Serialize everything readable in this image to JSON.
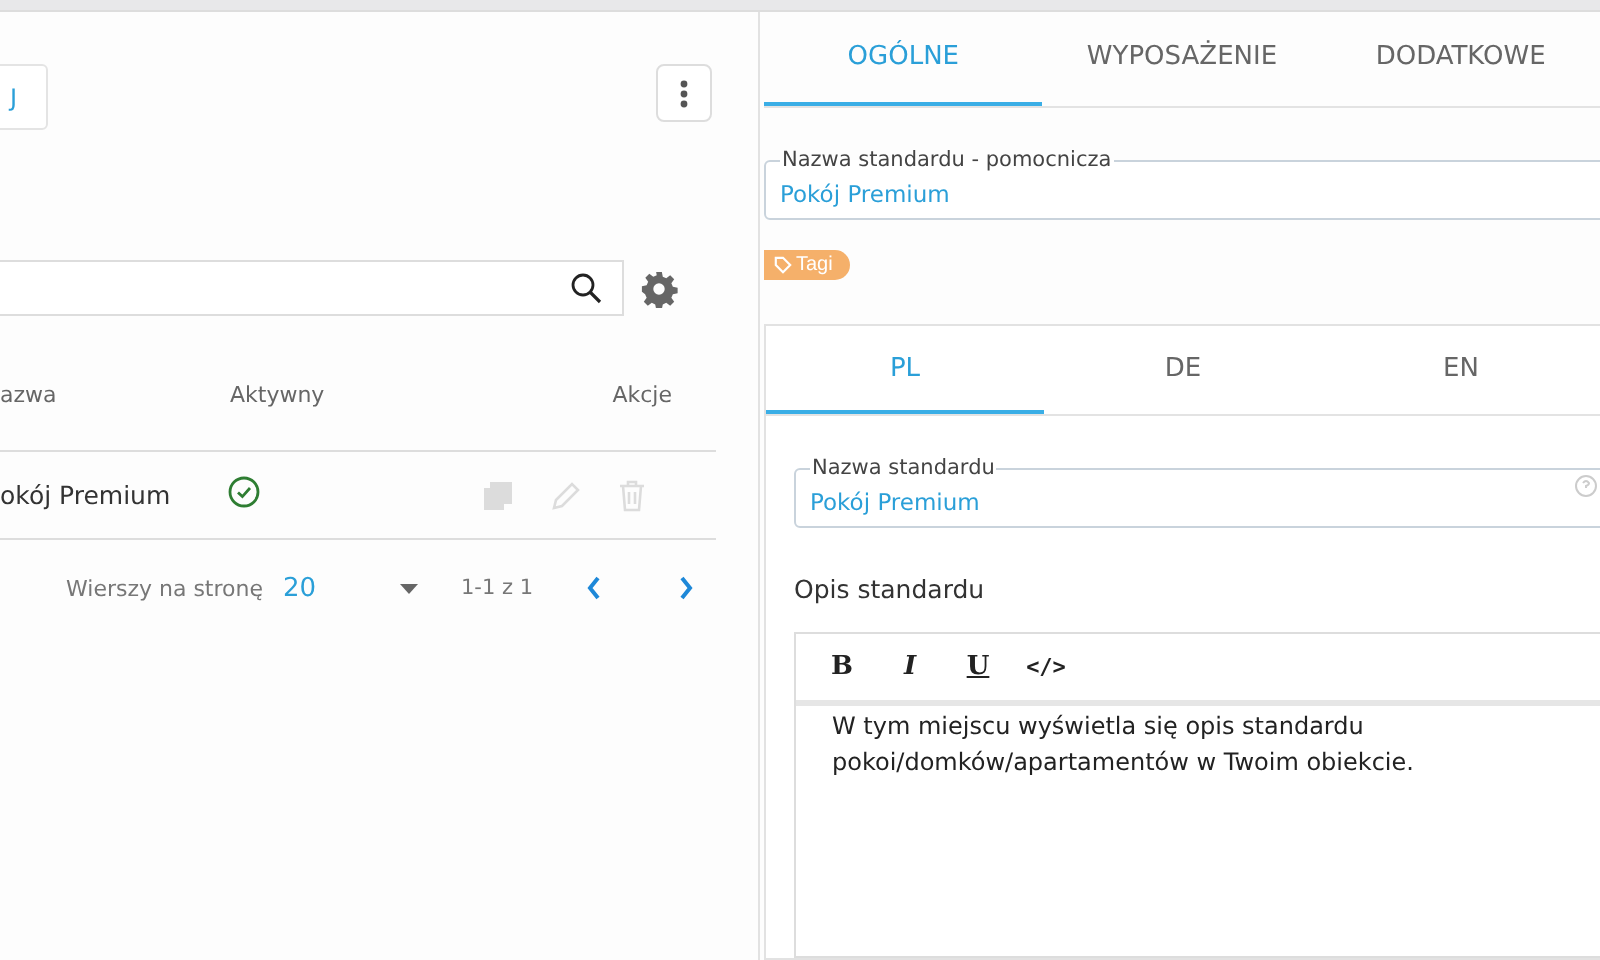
{
  "left_panel": {
    "add_button": {
      "label": "J"
    },
    "table": {
      "columns": [
        "azwa",
        "Aktywny",
        "Akcje"
      ],
      "rows": [
        {
          "name": "okój Premium",
          "active": true,
          "actions": [
            {
              "kind": "copy",
              "disabled": true
            },
            {
              "kind": "edit",
              "disabled": true
            },
            {
              "kind": "delete",
              "disabled": true
            }
          ]
        }
      ]
    },
    "pagination": {
      "rows_label": "Wierszy na stronę",
      "rows_value": "20",
      "range": "1-1 z 1"
    }
  },
  "right_panel": {
    "tabs": [
      {
        "label": "OGÓLNE",
        "selected": true
      },
      {
        "label": "WYPOSAŻENIE",
        "selected": false
      },
      {
        "label": "DODATKOWE",
        "selected": false
      }
    ],
    "helper_name_field": {
      "label": "Nazwa standardu - pomocnicza",
      "value": "Pokój Premium"
    },
    "tag_chip": {
      "label": "Tagi"
    },
    "language_tabs": [
      {
        "label": "PL",
        "selected": true
      },
      {
        "label": "DE",
        "selected": false
      },
      {
        "label": "EN",
        "selected": false
      }
    ],
    "name_field": {
      "label": "Nazwa standardu",
      "value": "Pokój Premium"
    },
    "description": {
      "heading": "Opis standardu",
      "toolbar": [
        {
          "kind": "bold",
          "label": "B"
        },
        {
          "kind": "italic",
          "label": "I"
        },
        {
          "kind": "underline",
          "label": "U"
        },
        {
          "kind": "code",
          "label": "</>"
        }
      ],
      "text": "W tym miejscu wyświetla się opis standardu pokoi/domków/apartamentów w Twoim obiekcie."
    }
  }
}
